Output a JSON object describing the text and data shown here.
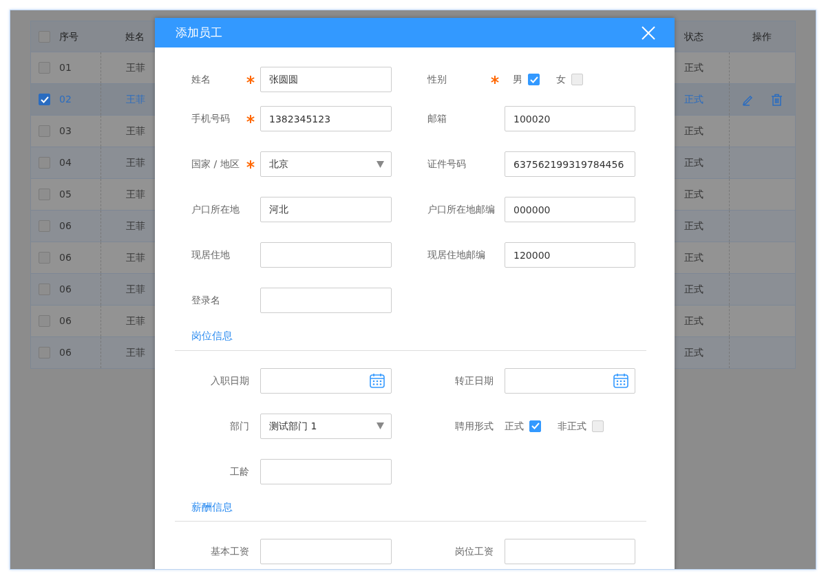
{
  "table": {
    "header_checked": false,
    "columns": [
      {
        "label": "序号"
      },
      {
        "label": "姓名"
      },
      {
        "label": "状态"
      },
      {
        "label": "操作"
      }
    ],
    "rows": [
      {
        "no": "01",
        "name": "王菲",
        "status": "正式",
        "selected": false
      },
      {
        "no": "02",
        "name": "王菲",
        "status": "正式",
        "selected": true
      },
      {
        "no": "03",
        "name": "王菲",
        "status": "正式",
        "selected": false
      },
      {
        "no": "04",
        "name": "王菲",
        "status": "正式",
        "selected": false
      },
      {
        "no": "05",
        "name": "王菲",
        "status": "正式",
        "selected": false
      },
      {
        "no": "06",
        "name": "王菲",
        "status": "正式",
        "selected": false
      },
      {
        "no": "06",
        "name": "王菲",
        "status": "正式",
        "selected": false
      },
      {
        "no": "06",
        "name": "王菲",
        "status": "正式",
        "selected": false
      },
      {
        "no": "06",
        "name": "王菲",
        "status": "正式",
        "selected": false
      },
      {
        "no": "06",
        "name": "王菲",
        "status": "正式",
        "selected": false
      }
    ]
  },
  "dialog": {
    "title": "添加员工",
    "sections": [
      {
        "fields": [
          {
            "kind": "text",
            "label": "姓名",
            "required": true,
            "value": "张圆圆"
          },
          {
            "kind": "checks",
            "label": "性别",
            "required": true,
            "options": [
              {
                "label": "男",
                "checked": true
              },
              {
                "label": "女",
                "checked": false
              }
            ]
          },
          {
            "kind": "text",
            "label": "手机号码",
            "required": true,
            "value": "1382345123"
          },
          {
            "kind": "text",
            "label": "邮箱",
            "required": false,
            "value": "100020"
          },
          {
            "kind": "select",
            "label": "国家 / 地区",
            "required": true,
            "value": "北京"
          },
          {
            "kind": "text",
            "label": "证件号码",
            "required": false,
            "value": "637562199319784456"
          },
          {
            "kind": "text",
            "label": "户口所在地",
            "required": false,
            "value": "河北"
          },
          {
            "kind": "text",
            "label": "户口所在地邮编",
            "required": false,
            "value": "000000"
          },
          {
            "kind": "text",
            "label": "现居住地",
            "required": false
          },
          {
            "kind": "text",
            "label": "现居住地邮编",
            "required": false,
            "value": "120000"
          },
          {
            "kind": "text",
            "label": "登录名",
            "required": false
          }
        ]
      },
      {
        "title": "岗位信息",
        "fields": [
          {
            "kind": "date",
            "label": "入职日期",
            "required": false
          },
          {
            "kind": "date",
            "label": "转正日期",
            "required": false
          },
          {
            "kind": "select",
            "label": "部门",
            "required": false,
            "value": "测试部门 1"
          },
          {
            "kind": "checks",
            "label": "聘用形式",
            "required": false,
            "options": [
              {
                "label": "正式",
                "checked": true
              },
              {
                "label": "非正式",
                "checked": false
              }
            ]
          },
          {
            "kind": "text",
            "label": "工龄",
            "required": false
          }
        ]
      },
      {
        "title": "薪酬信息",
        "fields": [
          {
            "kind": "text",
            "label": "基本工资",
            "required": false
          },
          {
            "kind": "text",
            "label": "岗位工资",
            "required": false
          }
        ]
      }
    ]
  }
}
